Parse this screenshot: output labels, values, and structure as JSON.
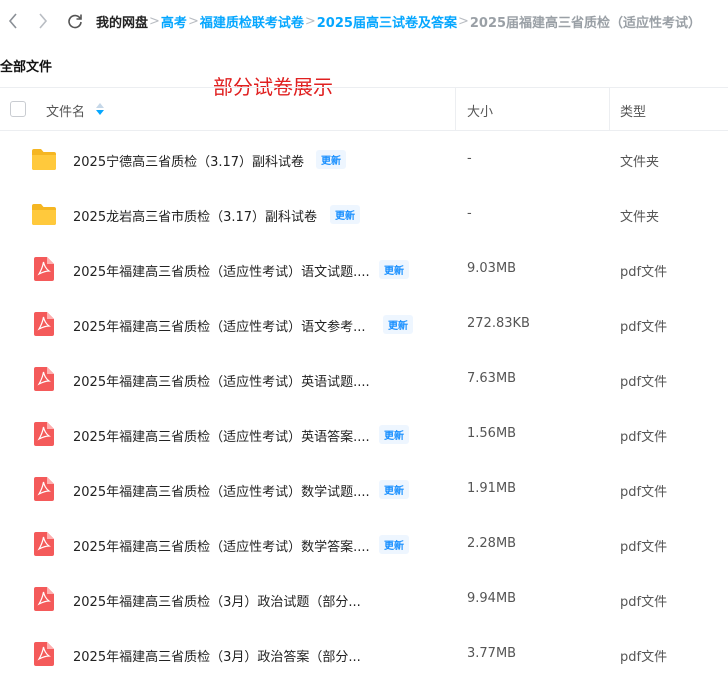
{
  "breadcrumb": [
    {
      "label": "我的网盘",
      "kind": "root"
    },
    {
      "label": "高考",
      "kind": "link"
    },
    {
      "label": "福建质检联考试卷",
      "kind": "link"
    },
    {
      "label": "2025届高三试卷及答案",
      "kind": "link"
    },
    {
      "label": "2025届福建高三省质检（适应性考试）",
      "kind": "current"
    }
  ],
  "page_title": "全部文件",
  "showcase_label": "部分试卷展示",
  "columns": {
    "name": "文件名",
    "size": "大小",
    "type": "类型"
  },
  "badge_label": "更新",
  "colors": {
    "accent": "#06a7ff",
    "folder": "#f5b622",
    "pdf": "#f45a5a",
    "badge": "#1a90ff"
  },
  "files": [
    {
      "name": "2025宁德高三省质检（3.17）副科试卷",
      "size": "-",
      "type": "文件夹",
      "icon": "folder-icon",
      "badge": true
    },
    {
      "name": "2025龙岩高三省市质检（3.17）副科试卷",
      "size": "-",
      "type": "文件夹",
      "icon": "folder-icon",
      "badge": true
    },
    {
      "name": "2025年福建高三省质检（适应性考试）语文试题....",
      "size": "9.03MB",
      "type": "pdf文件",
      "icon": "pdf-icon",
      "badge": true
    },
    {
      "name": "2025年福建高三省质检（适应性考试）语文参考...",
      "size": "272.83KB",
      "type": "pdf文件",
      "icon": "pdf-icon",
      "badge": true
    },
    {
      "name": "2025年福建高三省质检（适应性考试）英语试题....",
      "size": "7.63MB",
      "type": "pdf文件",
      "icon": "pdf-icon",
      "badge": false
    },
    {
      "name": "2025年福建高三省质检（适应性考试）英语答案....",
      "size": "1.56MB",
      "type": "pdf文件",
      "icon": "pdf-icon",
      "badge": true
    },
    {
      "name": "2025年福建高三省质检（适应性考试）数学试题....",
      "size": "1.91MB",
      "type": "pdf文件",
      "icon": "pdf-icon",
      "badge": true
    },
    {
      "name": "2025年福建高三省质检（适应性考试）数学答案....",
      "size": "2.28MB",
      "type": "pdf文件",
      "icon": "pdf-icon",
      "badge": true
    },
    {
      "name": "2025年福建高三省质检（3月）政治试题（部分...",
      "size": "9.94MB",
      "type": "pdf文件",
      "icon": "pdf-icon",
      "badge": false
    },
    {
      "name": "2025年福建高三省质检（3月）政治答案（部分...",
      "size": "3.77MB",
      "type": "pdf文件",
      "icon": "pdf-icon",
      "badge": false
    }
  ]
}
